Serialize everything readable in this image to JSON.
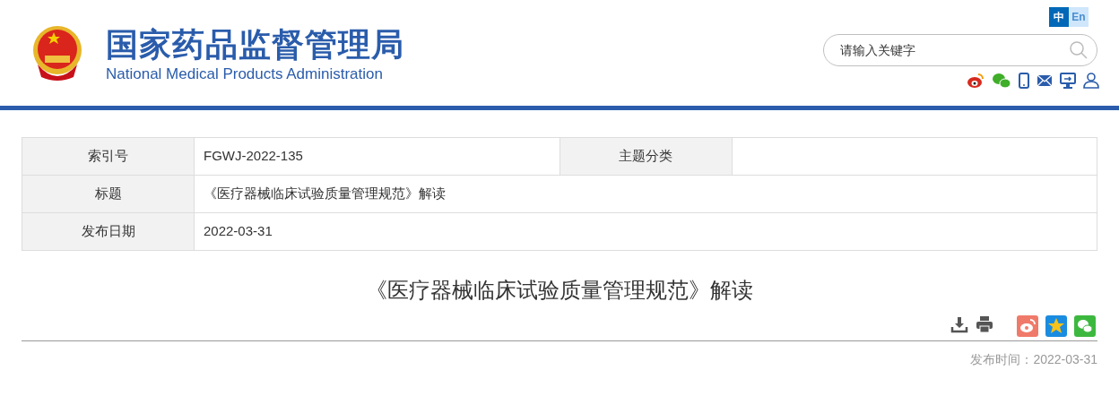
{
  "header": {
    "title": "国家药品监督管理局",
    "subtitle": "National Medical Products Administration",
    "languages": [
      {
        "label": "中",
        "selected": true
      },
      {
        "label": "En",
        "selected": false
      }
    ],
    "search": {
      "placeholder": "请输入关键字"
    }
  },
  "info_table": {
    "rows": [
      {
        "cells": [
          {
            "label": "索引号",
            "value": "FGWJ-2022-135"
          },
          {
            "label": "主题分类"
          }
        ]
      },
      {
        "cells": [
          {
            "label": "标题",
            "value": "《医疗器械临床试验质量管理规范》解读"
          }
        ]
      },
      {
        "cells": [
          {
            "label": "发布日期",
            "value": "2022-03-31"
          }
        ]
      }
    ]
  },
  "article": {
    "title": "《医疗器械临床试验质量管理规范》解读",
    "publish_time": "发布时间：2022-03-31"
  }
}
